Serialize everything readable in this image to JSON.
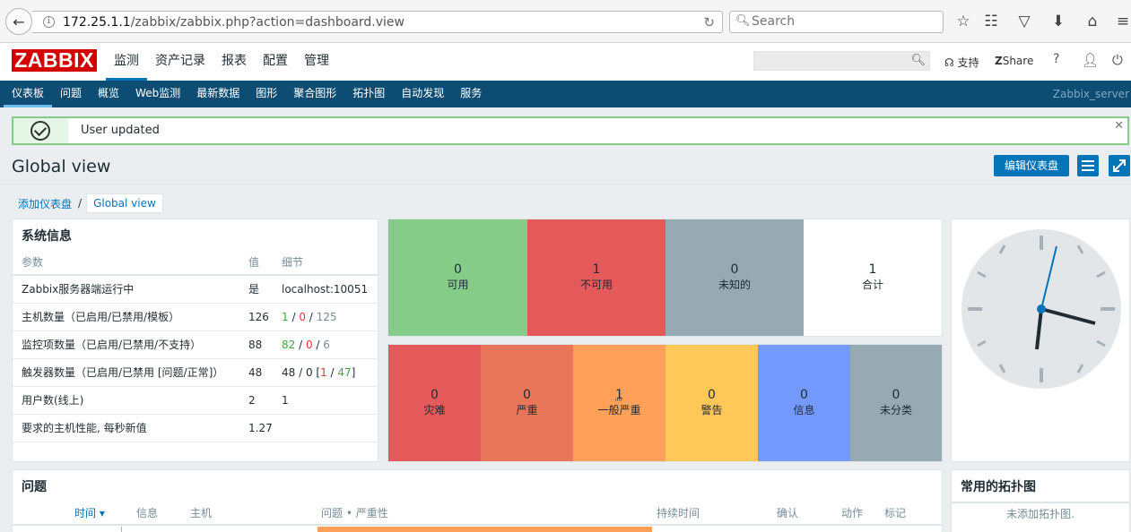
{
  "browser": {
    "url_host": "172.25.1.1",
    "url_path": "/zabbix/zabbix.php?action=dashboard.view",
    "search_placeholder": "Search"
  },
  "header": {
    "logo": "ZABBIX",
    "menu": [
      "监测",
      "资产记录",
      "报表",
      "配置",
      "管理"
    ],
    "support": "支持",
    "share": "Share",
    "help": "?"
  },
  "submenu": {
    "items": [
      "仪表板",
      "问题",
      "概览",
      "Web监测",
      "最新数据",
      "图形",
      "聚合图形",
      "拓扑图",
      "自动发现",
      "服务"
    ],
    "server": "Zabbix_server"
  },
  "message": {
    "text": "User updated"
  },
  "page": {
    "title": "Global view",
    "edit_button": "编辑仪表盘",
    "breadcrumb": {
      "parent": "添加仪表盘",
      "current": "Global view"
    }
  },
  "sysinfo": {
    "title": "系统信息",
    "headers": [
      "参数",
      "值",
      "细节"
    ],
    "rows": [
      {
        "param": "Zabbix服务器端运行中",
        "value": "是",
        "detail": "localhost:10051"
      },
      {
        "param": "主机数量（已启用/已禁用/模板）",
        "value": "126",
        "d1": "1",
        "d2": "0",
        "d3": "125"
      },
      {
        "param": "监控项数量（已启用/已禁用/不支持）",
        "value": "88",
        "d1": "82",
        "d2": "0",
        "d3": "6"
      },
      {
        "param": "触发器数量（已启用/已禁用 [问题/正常]）",
        "value": "48",
        "t1": "48 / 0 [",
        "t2": "1",
        "t3": " / ",
        "t4": "47",
        "t5": "]"
      },
      {
        "param": "用户数(线上)",
        "value": "2",
        "detail": "1"
      },
      {
        "param": "要求的主机性能, 每秒新值",
        "value": "1.27",
        "detail": ""
      }
    ]
  },
  "host_status": {
    "tiles": [
      {
        "count": "0",
        "label": "可用",
        "color": "#86cc89"
      },
      {
        "count": "1",
        "label": "不可用",
        "color": "#e45959"
      },
      {
        "count": "0",
        "label": "未知的",
        "color": "#97aab3"
      },
      {
        "count": "1",
        "label": "合计",
        "color": "#ffffff"
      }
    ]
  },
  "severity": {
    "tiles": [
      {
        "count": "0",
        "label": "灾难",
        "color": "#e45959"
      },
      {
        "count": "0",
        "label": "严重",
        "color": "#e97659"
      },
      {
        "count": "1",
        "label": "一般严重",
        "color": "#ffa059"
      },
      {
        "count": "0",
        "label": "警告",
        "color": "#ffc859"
      },
      {
        "count": "0",
        "label": "信息",
        "color": "#7499ff"
      },
      {
        "count": "0",
        "label": "未分类",
        "color": "#97aab3"
      }
    ]
  },
  "problems": {
    "title": "问题",
    "headers": [
      "时间 ▾",
      "信息",
      "主机",
      "问题 • 严重性",
      "持续时间",
      "确认",
      "动作",
      "标记"
    ]
  },
  "maps": {
    "title": "常用的拓扑图",
    "empty": "未添加拓扑图."
  }
}
